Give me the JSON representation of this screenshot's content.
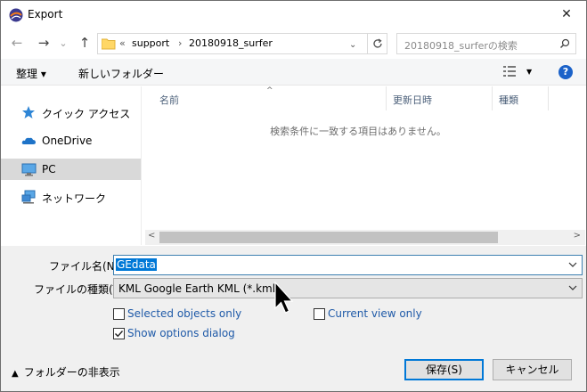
{
  "window": {
    "title": "Export",
    "close_glyph": "✕"
  },
  "nav": {
    "back_glyph": "←",
    "forward_glyph": "→",
    "recent_glyph": "⌄",
    "up_glyph": "↑",
    "address": {
      "overflow": "«",
      "crumbs": [
        "support",
        "20180918_surfer"
      ],
      "separator": "›"
    },
    "search_placeholder": "20180918_surferの検索"
  },
  "toolbar": {
    "organize_label": "整理 ▾",
    "new_folder_label": "新しいフォルダー",
    "help_label": "?"
  },
  "navpane": {
    "items": [
      {
        "label": "クイック アクセス",
        "icon": "star-icon"
      },
      {
        "label": "OneDrive",
        "icon": "cloud-icon"
      },
      {
        "label": "PC",
        "icon": "computer-icon",
        "selected": true
      },
      {
        "label": "ネットワーク",
        "icon": "network-icon"
      }
    ]
  },
  "filelist": {
    "columns": [
      "名前",
      "更新日時",
      "種類"
    ],
    "sort_indicator": "^",
    "empty_message": "検索条件に一致する項目はありません。",
    "scroll_left": "<",
    "scroll_right": ">"
  },
  "form": {
    "filename_label": "ファイル名(N):",
    "filename_value": "GEdata",
    "filetype_label": "ファイルの種類(T):",
    "filetype_value": "KML Google Earth KML (*.kml)",
    "options": [
      {
        "label": "Selected objects only",
        "checked": false
      },
      {
        "label": "Current view only",
        "checked": false
      },
      {
        "label": "Show options dialog",
        "checked": true
      }
    ]
  },
  "footer": {
    "hide_folders_label": "フォルダーの非表示",
    "save_label": "保存(S)",
    "cancel_label": "キャンセル"
  },
  "colors": {
    "accent": "#0078d7",
    "link": "#1f5aa8",
    "selection": "#d9d9d9"
  }
}
